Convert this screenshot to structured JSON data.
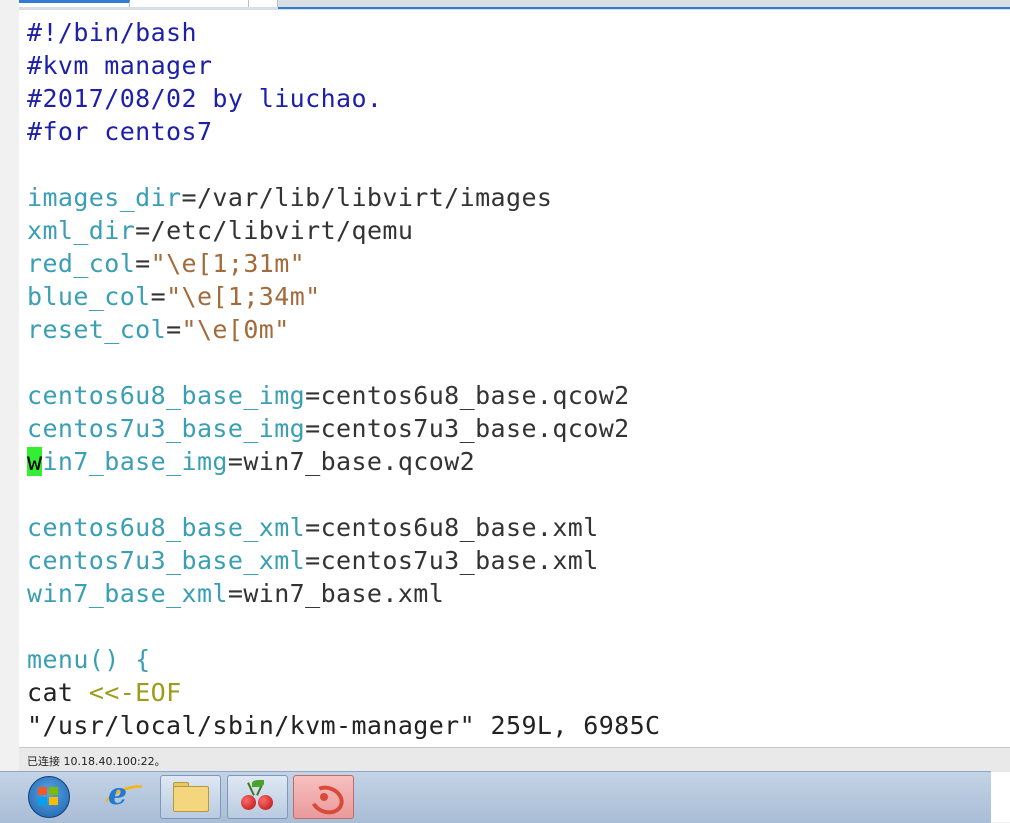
{
  "editor": {
    "lines": [
      [
        {
          "t": "#!/bin/bash",
          "c": "cm"
        }
      ],
      [
        {
          "t": "#kvm manager",
          "c": "cm"
        }
      ],
      [
        {
          "t": "#2017/08/02 by liuchao.",
          "c": "cm"
        }
      ],
      [
        {
          "t": "#for centos7",
          "c": "cm"
        }
      ],
      [],
      [
        {
          "t": "images_dir",
          "c": "var"
        },
        {
          "t": "=/var/lib/libvirt/images",
          "c": "op"
        }
      ],
      [
        {
          "t": "xml_dir",
          "c": "var"
        },
        {
          "t": "=/etc/libvirt/qemu",
          "c": "op"
        }
      ],
      [
        {
          "t": "red_col",
          "c": "var"
        },
        {
          "t": "=",
          "c": "op"
        },
        {
          "t": "\"\\e[1;31m\"",
          "c": "str"
        }
      ],
      [
        {
          "t": "blue_col",
          "c": "var"
        },
        {
          "t": "=",
          "c": "op"
        },
        {
          "t": "\"\\e[1;34m\"",
          "c": "str"
        }
      ],
      [
        {
          "t": "reset_col",
          "c": "var"
        },
        {
          "t": "=",
          "c": "op"
        },
        {
          "t": "\"\\e[0m\"",
          "c": "str"
        }
      ],
      [],
      [
        {
          "t": "centos6u8_base_img",
          "c": "var"
        },
        {
          "t": "=centos6u8_base.qcow2",
          "c": "op"
        }
      ],
      [
        {
          "t": "centos7u3_base_img",
          "c": "var"
        },
        {
          "t": "=centos7u3_base.qcow2",
          "c": "op"
        }
      ],
      [
        {
          "t": "w",
          "c": "cursor"
        },
        {
          "t": "in7_base_img",
          "c": "var"
        },
        {
          "t": "=win7_base.qcow2",
          "c": "op"
        }
      ],
      [],
      [
        {
          "t": "centos6u8_base_xml",
          "c": "var"
        },
        {
          "t": "=centos6u8_base.xml",
          "c": "op"
        }
      ],
      [
        {
          "t": "centos7u3_base_xml",
          "c": "var"
        },
        {
          "t": "=centos7u3_base.xml",
          "c": "op"
        }
      ],
      [
        {
          "t": "win7_base_xml",
          "c": "var"
        },
        {
          "t": "=win7_base.xml",
          "c": "op"
        }
      ],
      [],
      [
        {
          "t": "menu() {",
          "c": "var"
        }
      ],
      [
        {
          "t": "cat ",
          "c": "plain"
        },
        {
          "t": "<<-EOF",
          "c": "eof"
        }
      ],
      [
        {
          "t": "\"/usr/local/sbin/kvm-manager\" 259L, 6985C",
          "c": "plain"
        }
      ]
    ]
  },
  "status": {
    "text": "已连接 10.18.40.100:22。"
  },
  "taskbar": {
    "items": [
      {
        "name": "windows-start-icon"
      },
      {
        "name": "internet-explorer-icon"
      },
      {
        "name": "file-explorer-icon"
      },
      {
        "name": "cherry-app-icon"
      },
      {
        "name": "swirl-app-icon"
      }
    ]
  }
}
